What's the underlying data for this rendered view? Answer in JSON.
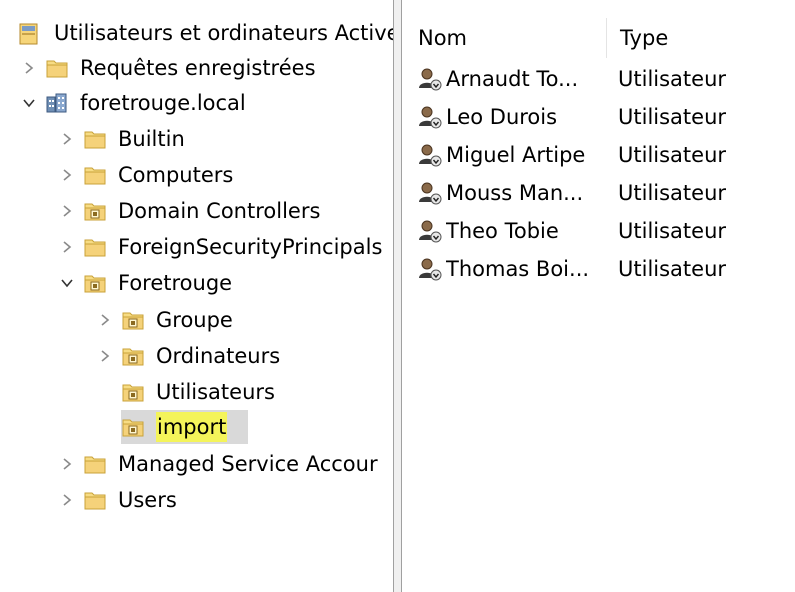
{
  "tree": {
    "root_label": "Utilisateurs et ordinateurs Active",
    "items": [
      {
        "label": "Requêtes enregistrées"
      },
      {
        "label": "foretrouge.local"
      },
      {
        "label": "Builtin"
      },
      {
        "label": "Computers"
      },
      {
        "label": "Domain Controllers"
      },
      {
        "label": "ForeignSecurityPrincipals"
      },
      {
        "label": "Foretrouge"
      },
      {
        "label": "Groupe"
      },
      {
        "label": "Ordinateurs"
      },
      {
        "label": "Utilisateurs"
      },
      {
        "label": "import"
      },
      {
        "label": "Managed Service Accour"
      },
      {
        "label": "Users"
      }
    ],
    "selected": "import"
  },
  "list": {
    "columns": [
      "Nom",
      "Type"
    ],
    "rows": [
      {
        "name": "Arnaudt To...",
        "type": "Utilisateur"
      },
      {
        "name": "Leo Durois",
        "type": "Utilisateur"
      },
      {
        "name": "Miguel Artipe",
        "type": "Utilisateur"
      },
      {
        "name": "Mouss Man...",
        "type": "Utilisateur"
      },
      {
        "name": "Theo Tobie",
        "type": "Utilisateur"
      },
      {
        "name": "Thomas Boi...",
        "type": "Utilisateur"
      }
    ]
  },
  "icons": {
    "root": "ad-console-icon",
    "saved-queries": "folder-icon",
    "domain": "domain-building-icon",
    "container": "folder-icon",
    "ou": "ou-folder-icon",
    "user": "user-icon"
  },
  "colors": {
    "folder": "#f5d77a",
    "selection": "#d9d9d9",
    "highlight": "#f4f45a"
  }
}
